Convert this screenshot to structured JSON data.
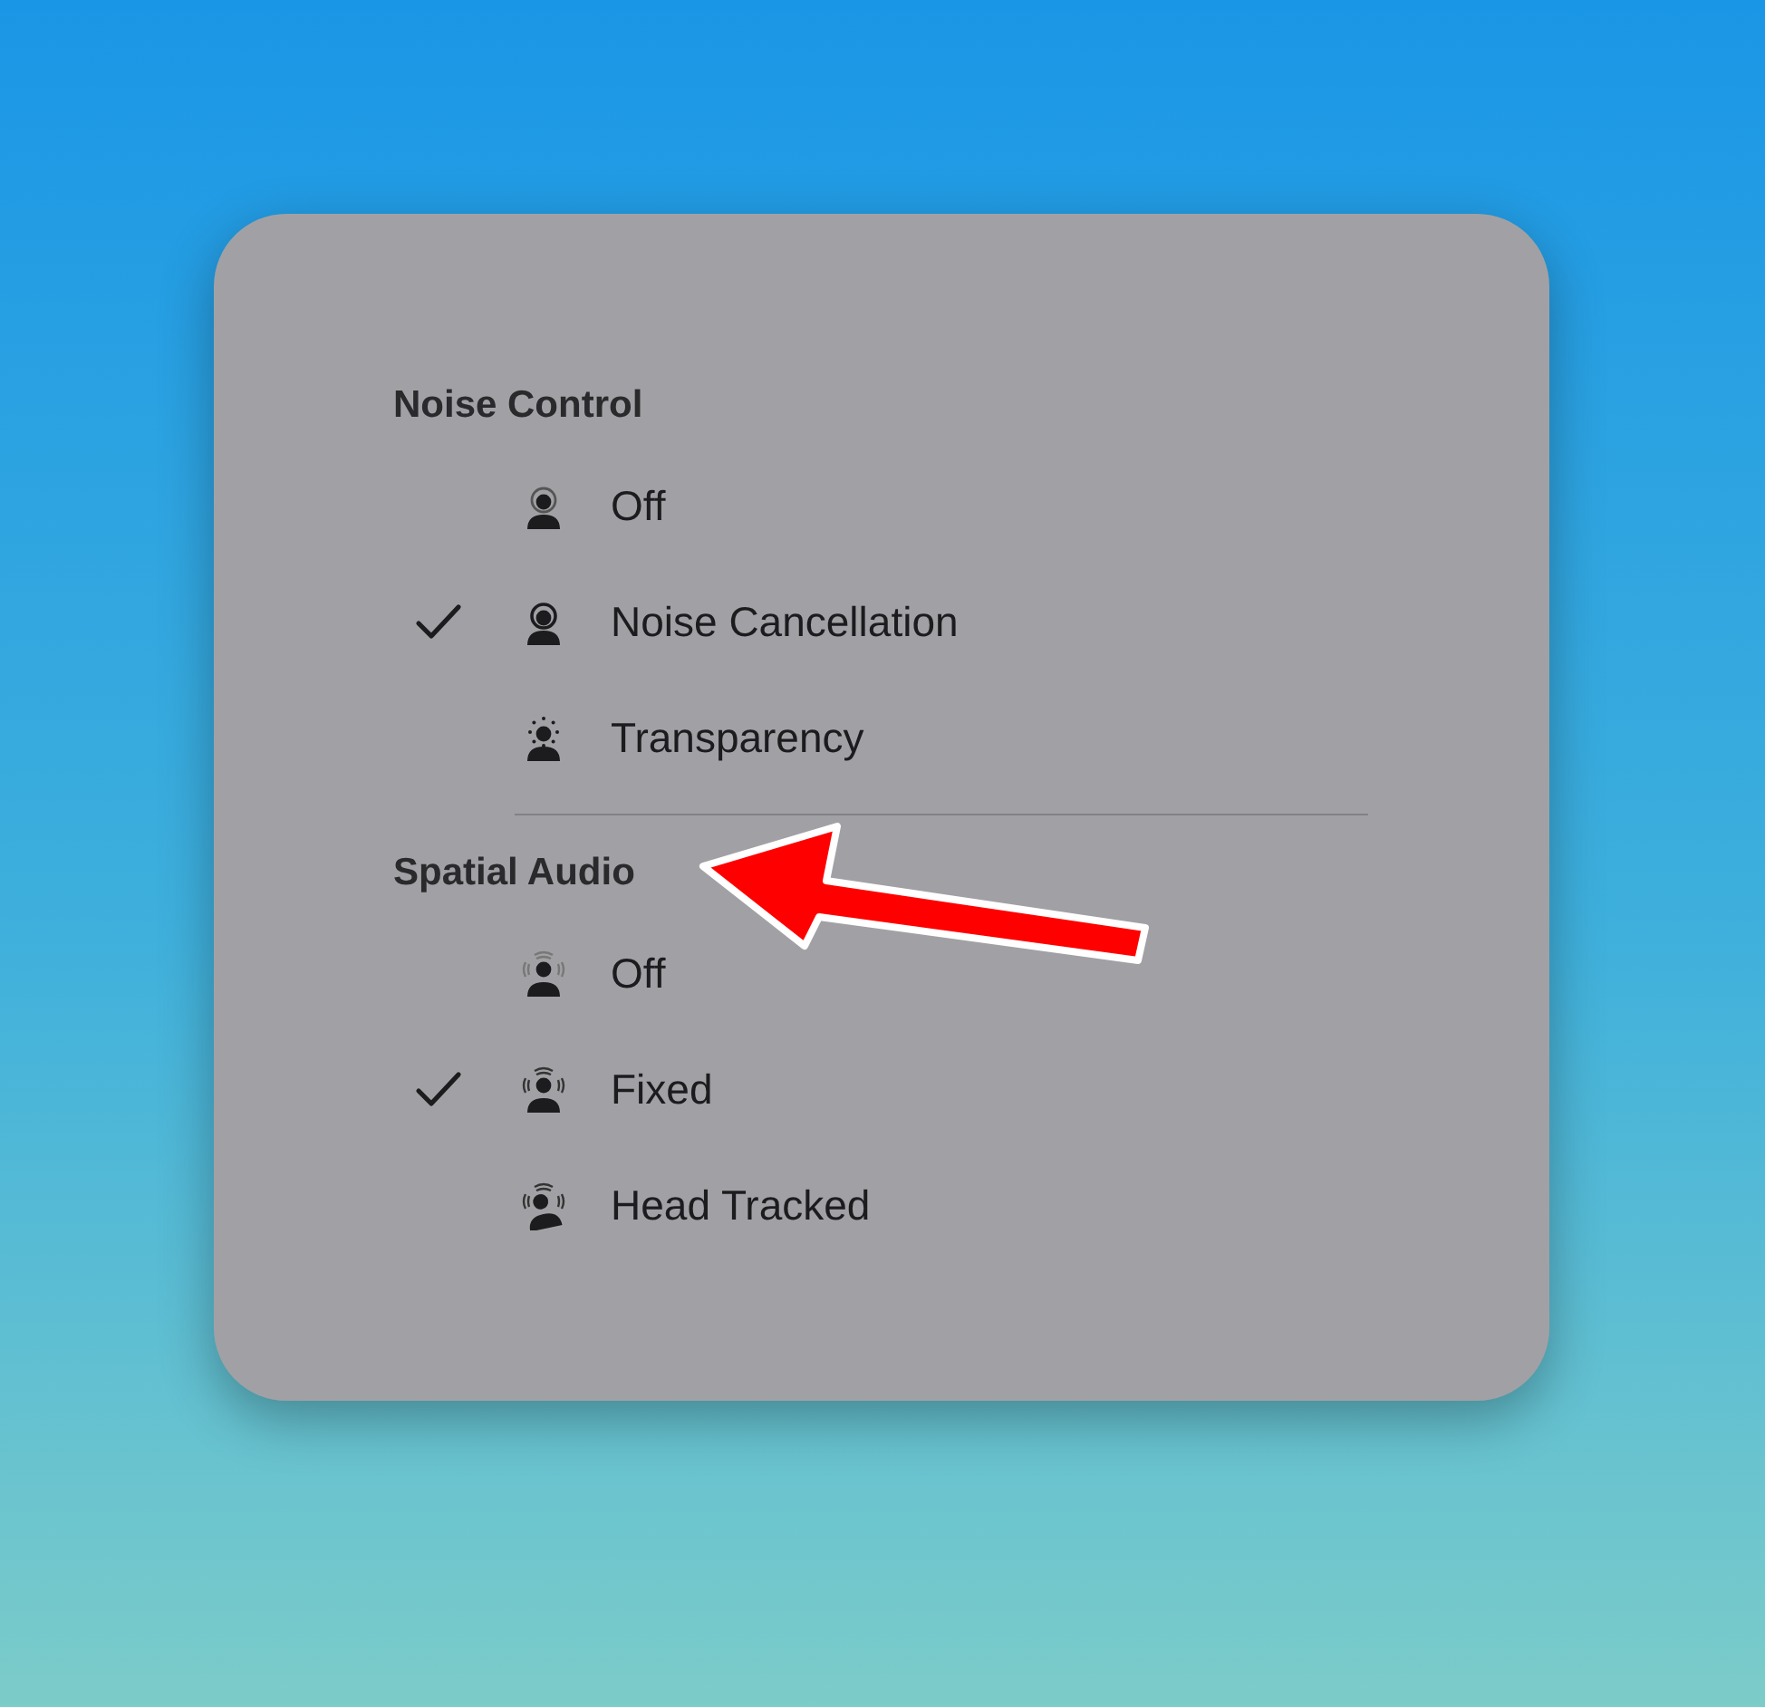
{
  "sections": [
    {
      "title": "Noise Control",
      "items": [
        {
          "label": "Off",
          "kind": "ring",
          "selected": false
        },
        {
          "label": "Noise Cancellation",
          "kind": "ring-bold",
          "selected": true
        },
        {
          "label": "Transparency",
          "kind": "dots",
          "selected": false
        }
      ]
    },
    {
      "title": "Spatial Audio",
      "items": [
        {
          "label": "Off",
          "kind": "waves-faint",
          "selected": false
        },
        {
          "label": "Fixed",
          "kind": "waves",
          "selected": true
        },
        {
          "label": "Head Tracked",
          "kind": "waves-tilted",
          "selected": false
        }
      ]
    }
  ]
}
